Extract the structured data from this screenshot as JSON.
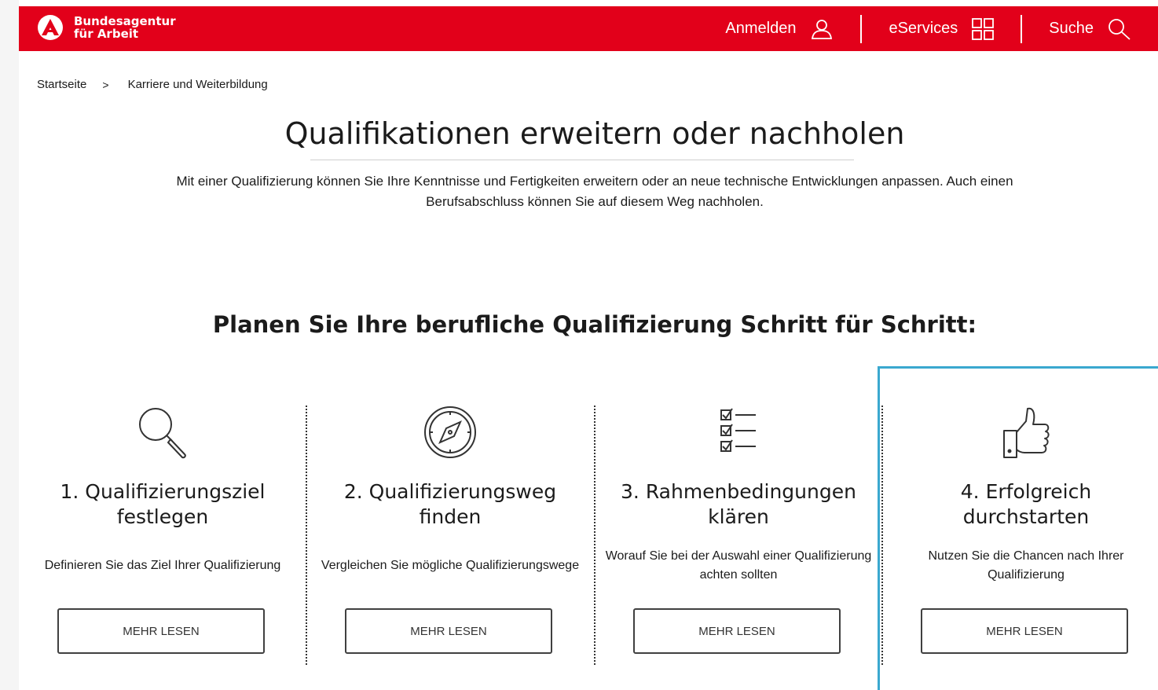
{
  "header": {
    "logo_line1": "Bundesagentur",
    "logo_line2": "für Arbeit",
    "login_label": "Anmelden",
    "eservices_label": "eServices",
    "search_label": "Suche",
    "brand_color": "#e2001a"
  },
  "breadcrumb": {
    "home": "Startseite",
    "separator": ">",
    "current": "Karriere und Weiterbildung"
  },
  "main": {
    "title": "Qualifikationen erweitern oder nachholen",
    "intro": "Mit einer Qualifizierung können Sie Ihre Kenntnisse und Fertigkeiten erweitern oder an neue technische Entwicklungen anpassen. Auch einen Berufsabschluss können Sie auf diesem Weg nachholen.",
    "steps_heading": "Planen Sie Ihre berufliche Qualifizierung Schritt für Schritt:"
  },
  "steps": [
    {
      "icon": "magnifier-icon",
      "title_line1": "1. Qualifizierungsziel",
      "title_line2": "festlegen",
      "desc": "Definieren Sie das Ziel Ihrer Qualifizierung",
      "button": "MEHR LESEN"
    },
    {
      "icon": "compass-icon",
      "title_line1": "2. Qualifizierungsweg",
      "title_line2": "finden",
      "desc": "Vergleichen Sie mögliche Qualifizierungswege",
      "button": "MEHR LESEN"
    },
    {
      "icon": "checklist-icon",
      "title_line1": "3. Rahmenbedingungen",
      "title_line2": "klären",
      "desc": "Worauf Sie bei der Auswahl einer Qualifizierung achten sollten",
      "button": "MEHR LESEN"
    },
    {
      "icon": "thumbs-up-icon",
      "title_line1": "4. Erfolgreich",
      "title_line2": "durchstarten",
      "desc": "Nutzen Sie die Chancen nach Ihrer Qualifizierung",
      "button": "MEHR LESEN"
    }
  ],
  "highlight_color": "#3aa8cf"
}
